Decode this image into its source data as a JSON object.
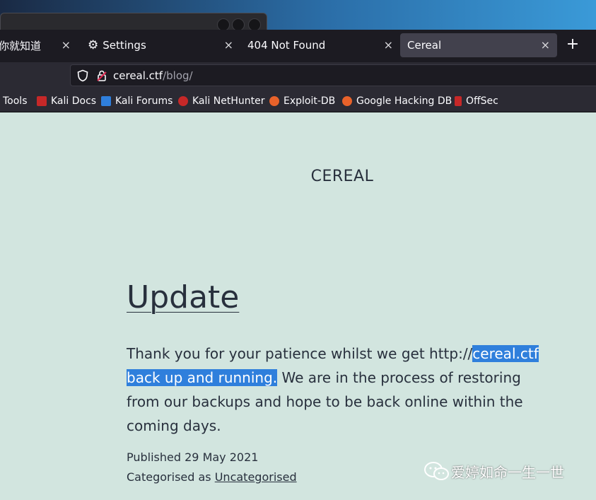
{
  "tabs": [
    {
      "label": "你就知道",
      "active": false
    },
    {
      "label": "Settings",
      "active": false,
      "icon": "gear-icon"
    },
    {
      "label": "404 Not Found",
      "active": false
    },
    {
      "label": "Cereal",
      "active": true
    }
  ],
  "tab_close_glyph": "×",
  "new_tab_glyph": "+",
  "address": {
    "host": "cereal.ctf",
    "path": "/blog/"
  },
  "bookmarks": [
    {
      "label": "Tools",
      "icon_color": ""
    },
    {
      "label": "Kali Docs",
      "icon_color": "#c62828"
    },
    {
      "label": "Kali Forums",
      "icon_color": "#2f7fdc"
    },
    {
      "label": "Kali NetHunter",
      "icon_color": "#c62828"
    },
    {
      "label": "Exploit-DB",
      "icon_color": "#e8622a"
    },
    {
      "label": "Google Hacking DB",
      "icon_color": "#e8622a"
    },
    {
      "label": "OffSec",
      "icon_color": "#c62828"
    }
  ],
  "page": {
    "site_title": "CEREAL",
    "post_title": "Update",
    "body_pre": "Thank you for your patience whilst we get http://",
    "body_selected": "cereal.ctf back up and running.",
    "body_post": " We are in the process of restoring from our backups and hope to be back online within the coming days.",
    "published_label": "Published",
    "published_date": "29 May 2021",
    "categorised_label": "Categorised as",
    "category": "Uncategorised"
  },
  "watermark": "爱婷如命一生一世",
  "colors": {
    "page_bg": "#d2e5df",
    "text": "#28303d",
    "selection": "#2f7fdc",
    "chrome_dark": "#1c1b22"
  }
}
